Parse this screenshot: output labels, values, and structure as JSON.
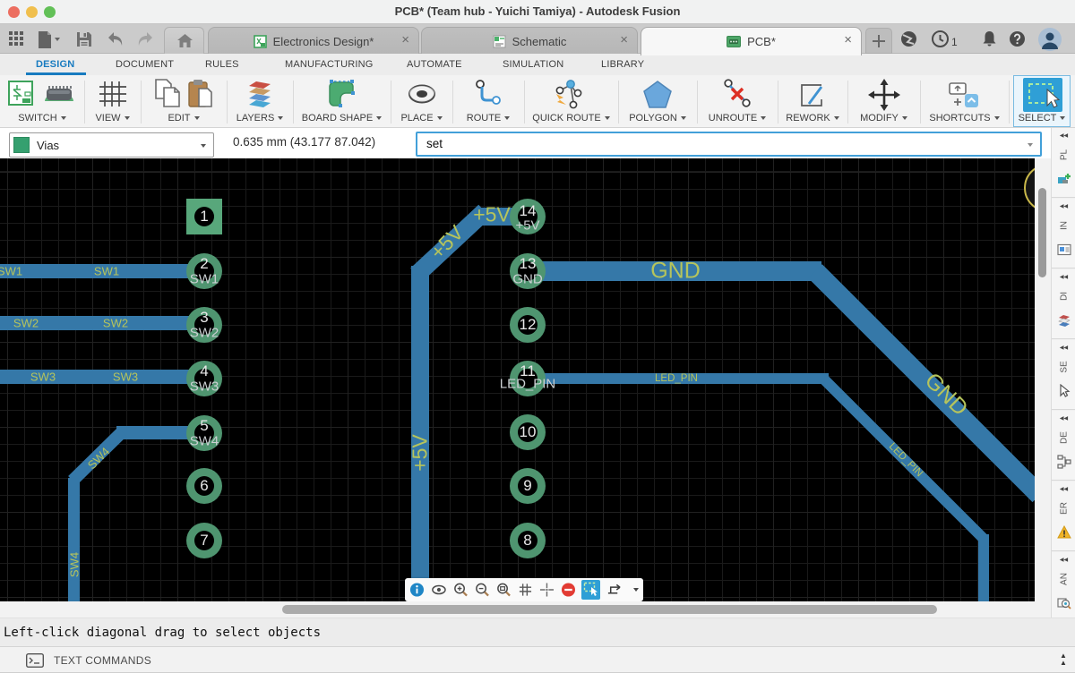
{
  "window": {
    "title": "PCB* (Team hub - Yuichi Tamiya) - Autodesk Fusion"
  },
  "tabbar": {
    "tabs": [
      {
        "label": "Electronics Design*",
        "active": false
      },
      {
        "label": "Schematic",
        "active": false
      },
      {
        "label": "PCB*",
        "active": true
      }
    ],
    "close_glyph": "×",
    "notification_count": "1",
    "left_icons": [
      "app-grid-icon",
      "file-menu-icon",
      "save-icon",
      "undo-icon",
      "redo-icon",
      "home-icon"
    ],
    "right_icons": [
      "new-tab-button",
      "extensions-globe-icon",
      "job-status-clock-icon",
      "notifications-bell-icon",
      "help-icon",
      "user-avatar"
    ]
  },
  "menu": {
    "items": [
      {
        "label": "DESIGN",
        "active": true
      },
      {
        "label": "DOCUMENT"
      },
      {
        "label": "RULES"
      },
      {
        "label": "MANUFACTURING"
      },
      {
        "label": "AUTOMATE"
      },
      {
        "label": "SIMULATION"
      },
      {
        "label": "LIBRARY"
      }
    ]
  },
  "toolbar": {
    "groups": [
      {
        "label": "SWITCH"
      },
      {
        "label": "VIEW"
      },
      {
        "label": "EDIT"
      },
      {
        "label": "LAYERS"
      },
      {
        "label": "BOARD SHAPE"
      },
      {
        "label": "PLACE"
      },
      {
        "label": "ROUTE"
      },
      {
        "label": "QUICK ROUTE"
      },
      {
        "label": "POLYGON"
      },
      {
        "label": "UNROUTE"
      },
      {
        "label": "REWORK"
      },
      {
        "label": "MODIFY"
      },
      {
        "label": "SHORTCUTS"
      },
      {
        "label": "SELECT",
        "active": true
      }
    ]
  },
  "view_toolbar": {
    "tools": [
      "info-icon",
      "visibility-eye-icon",
      "zoom-in-icon",
      "zoom-out-icon",
      "zoom-fit-icon",
      "grid-settings-icon",
      "crosshair-icon",
      "stop-icon",
      "select-tool-icon",
      "route-options-icon"
    ]
  },
  "controlbar": {
    "layer_selector": {
      "value": "Vias",
      "swatch_color": "#35a06f"
    },
    "coordinates": "0.635 mm (43.177 87.042)",
    "command_input": {
      "value": "set"
    }
  },
  "canvas": {
    "pads": [
      {
        "number": "1",
        "net": ""
      },
      {
        "number": "2",
        "net": "SW1"
      },
      {
        "number": "3",
        "net": "SW2"
      },
      {
        "number": "4",
        "net": "SW3"
      },
      {
        "number": "5",
        "net": "SW4"
      },
      {
        "number": "6",
        "net": ""
      },
      {
        "number": "7",
        "net": ""
      },
      {
        "number": "14",
        "net": "+5V"
      },
      {
        "number": "13",
        "net": "GND"
      },
      {
        "number": "12",
        "net": ""
      },
      {
        "number": "11",
        "net": "LED_PIN"
      },
      {
        "number": "10",
        "net": ""
      },
      {
        "number": "9",
        "net": ""
      },
      {
        "number": "8",
        "net": ""
      }
    ],
    "trace_labels": [
      {
        "text": "SW1"
      },
      {
        "text": "SW1"
      },
      {
        "text": "SW2"
      },
      {
        "text": "SW2"
      },
      {
        "text": "SW3"
      },
      {
        "text": "SW3"
      },
      {
        "text": "SW4"
      },
      {
        "text": "SW4"
      },
      {
        "text": "+5V"
      },
      {
        "text": "+5V"
      },
      {
        "text": "+5V"
      },
      {
        "text": "GND"
      },
      {
        "text": "GND"
      },
      {
        "text": "LED_PIN"
      },
      {
        "text": "LED_PIN"
      }
    ],
    "trace_color": "#3578a8",
    "pad_color": "#4f9570",
    "label_color": "#b6c45c"
  },
  "statusbar": {
    "message": "Left-click diagonal drag to select objects"
  },
  "text_commands": {
    "label": "TEXT COMMANDS",
    "expand_glyph": "▲\n▲"
  },
  "side_panels": [
    {
      "label": "PL",
      "icon": "place-icon"
    },
    {
      "label": "IN",
      "icon": "inspect-icon"
    },
    {
      "label": "DI",
      "icon": "display-icon"
    },
    {
      "label": "SE",
      "icon": "selection-icon"
    },
    {
      "label": "DE",
      "icon": "design-icon"
    },
    {
      "label": "ER",
      "icon": "errors-icon"
    },
    {
      "label": "AN",
      "icon": "analyze-icon"
    }
  ]
}
